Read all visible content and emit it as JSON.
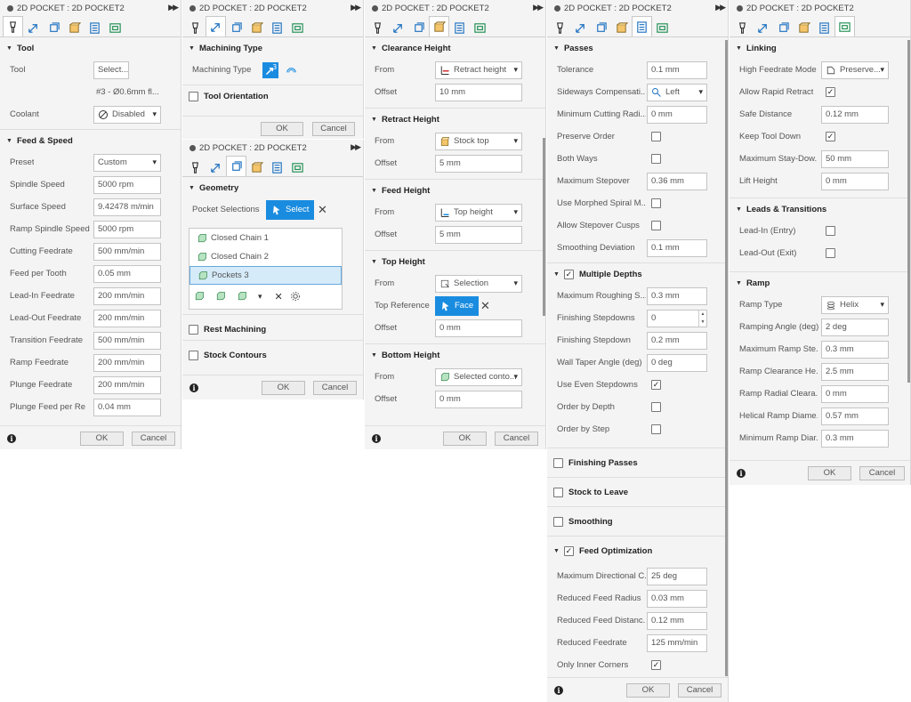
{
  "common": {
    "title": "2D POCKET : 2D POCKET2",
    "ok": "OK",
    "cancel": "Cancel",
    "info": "i"
  },
  "p1": {
    "tool_section": "Tool",
    "tool_label": "Tool",
    "tool_value": "Select...",
    "tool_desc": "#3 - Ø0.6mm fl...",
    "coolant_label": "Coolant",
    "coolant_value": "Disabled",
    "feed_section": "Feed & Speed",
    "rows": [
      {
        "label": "Preset",
        "value": "Custom"
      },
      {
        "label": "Spindle Speed",
        "value": "5000 rpm"
      },
      {
        "label": "Surface Speed",
        "value": "9.42478 m/min"
      },
      {
        "label": "Ramp Spindle Speed",
        "value": "5000 rpm"
      },
      {
        "label": "Cutting Feedrate",
        "value": "500 mm/min"
      },
      {
        "label": "Feed per Tooth",
        "value": "0.05 mm"
      },
      {
        "label": "Lead-In Feedrate",
        "value": "200 mm/min"
      },
      {
        "label": "Lead-Out Feedrate",
        "value": "200 mm/min"
      },
      {
        "label": "Transition Feedrate",
        "value": "500 mm/min"
      },
      {
        "label": "Ramp Feedrate",
        "value": "200 mm/min"
      },
      {
        "label": "Plunge Feedrate",
        "value": "200 mm/min"
      },
      {
        "label": "Plunge Feed per Re",
        "value": "0.04 mm"
      }
    ]
  },
  "p2a": {
    "machining_section": "Machining Type",
    "machining_label": "Machining Type",
    "orientation_section": "Tool Orientation"
  },
  "p2b": {
    "geometry_section": "Geometry",
    "pocket_label": "Pocket Selections",
    "select_label": "Select",
    "chains": [
      "Closed Chain 1",
      "Closed Chain 2",
      "Pockets 3"
    ],
    "rest_section": "Rest Machining",
    "stock_section": "Stock Contours"
  },
  "p3": {
    "clearance_section": "Clearance Height",
    "retract_section": "Retract Height",
    "feed_section": "Feed Height",
    "top_section": "Top Height",
    "bottom_section": "Bottom Height",
    "from_label": "From",
    "offset_label": "Offset",
    "topref_label": "Top Reference",
    "clearance_from": "Retract height",
    "clearance_offset": "10 mm",
    "retract_from": "Stock top",
    "retract_offset": "5 mm",
    "feed_from": "Top height",
    "feed_offset": "5 mm",
    "top_from": "Selection",
    "top_ref": "Face",
    "top_offset": "0 mm",
    "bottom_from": "Selected conto...",
    "bottom_offset": "0 mm"
  },
  "p4": {
    "passes_section": "Passes",
    "tolerance_label": "Tolerance",
    "tolerance_value": "0.1 mm",
    "sideways_label": "Sideways Compensati...",
    "sideways_value": "Left",
    "mincut_label": "Minimum Cutting Radi...",
    "mincut_value": "0 mm",
    "preserve_label": "Preserve Order",
    "both_label": "Both Ways",
    "stepover_label": "Maximum Stepover",
    "stepover_value": "0.36 mm",
    "morphed_label": "Use Morphed Spiral M...",
    "cusps_label": "Allow Stepover Cusps",
    "smooth_label": "Smoothing Deviation",
    "smooth_value": "0.1 mm",
    "depths_section": "Multiple Depths",
    "rough_label": "Maximum Roughing S...",
    "rough_value": "0.3 mm",
    "finsteps_label": "Finishing Stepdowns",
    "finsteps_value": "0",
    "finstep_label": "Finishing Stepdown",
    "finstep_value": "0.2 mm",
    "taper_label": "Wall Taper Angle (deg)",
    "taper_value": "0 deg",
    "even_label": "Use Even Stepdowns",
    "order_depth_label": "Order by Depth",
    "order_step_label": "Order by Step",
    "finishing_section": "Finishing Passes",
    "stock_section": "Stock to Leave",
    "smoothing_section": "Smoothing",
    "feedopt_section": "Feed Optimization",
    "maxdir_label": "Maximum Directional C...",
    "maxdir_value": "25 deg",
    "redrad_label": "Reduced Feed Radius",
    "redrad_value": "0.03 mm",
    "reddist_label": "Reduced Feed Distanc...",
    "reddist_value": "0.12 mm",
    "redfeed_label": "Reduced Feedrate",
    "redfeed_value": "125 mm/min",
    "inner_label": "Only Inner Corners"
  },
  "p5": {
    "linking_section": "Linking",
    "hfm_label": "High Feedrate Mode",
    "hfm_value": "Preserve...",
    "rapid_label": "Allow Rapid Retract",
    "safe_label": "Safe Distance",
    "safe_value": "0.12 mm",
    "keep_label": "Keep Tool Down",
    "stay_label": "Maximum Stay-Dow...",
    "stay_value": "50 mm",
    "lift_label": "Lift Height",
    "lift_value": "0 mm",
    "leads_section": "Leads & Transitions",
    "leadin_label": "Lead-In (Entry)",
    "leadout_label": "Lead-Out (Exit)",
    "ramp_section": "Ramp",
    "ramptype_label": "Ramp Type",
    "ramptype_value": "Helix",
    "rampangle_label": "Ramping Angle (deg)",
    "rampangle_value": "2 deg",
    "rampstep_label": "Maximum Ramp Ste...",
    "rampstep_value": "0.3 mm",
    "rampclear_label": "Ramp Clearance He...",
    "rampclear_value": "2.5 mm",
    "rampradial_label": "Ramp Radial Cleara...",
    "rampradial_value": "0 mm",
    "helical_label": "Helical Ramp Diame...",
    "helical_value": "0.57 mm",
    "minramp_label": "Minimum Ramp Diar...",
    "minramp_value": "0.3 mm"
  },
  "colors": {
    "accent": "#1a8ce0",
    "panel_bg": "#f4f4f4"
  }
}
